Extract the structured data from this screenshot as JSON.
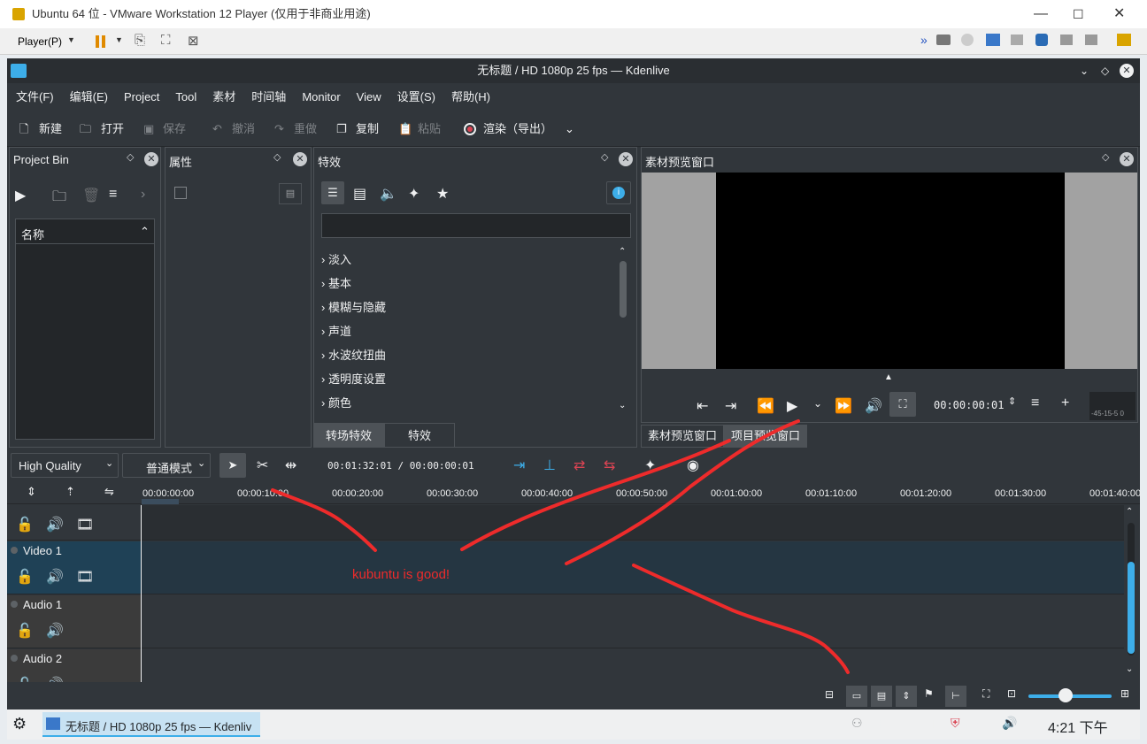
{
  "vmware": {
    "title": "Ubuntu 64 位 - VMware Workstation 12 Player (仅用于非商业用途)",
    "player_menu": "Player(P)"
  },
  "window": {
    "title": "无标题 / HD 1080p 25 fps — Kdenlive"
  },
  "menu": [
    "文件(F)",
    "编辑(E)",
    "Project",
    "Tool",
    "素材",
    "时间轴",
    "Monitor",
    "View",
    "设置(S)",
    "帮助(H)"
  ],
  "toolbar": {
    "new": "新建",
    "open": "打开",
    "save": "保存",
    "undo": "撤消",
    "redo": "重做",
    "copy": "复制",
    "paste": "粘贴",
    "render": "渲染（导出）"
  },
  "project_bin": {
    "title": "Project Bin",
    "column": "名称"
  },
  "properties": {
    "title": "属性"
  },
  "effects": {
    "title": "特效",
    "search_placeholder": "",
    "categories": [
      "淡入",
      "基本",
      "模糊与隐藏",
      "声道",
      "水波纹扭曲",
      "透明度设置",
      "颜色"
    ],
    "tabs": [
      "转场特效",
      "特效"
    ]
  },
  "monitor": {
    "title": "素材预览窗口",
    "timecode": "00:00:00:01",
    "tabs": [
      "素材预览窗口",
      "项目预览窗口"
    ],
    "meter_scale": "-45-15-5 0"
  },
  "timeline_toolbar": {
    "quality": "High Quality",
    "mode": "普通模式",
    "position": "00:01:32:01 / 00:00:00:01"
  },
  "ruler": [
    "00:00:00:00",
    "00:00:10:00",
    "00:00:20:00",
    "00:00:30:00",
    "00:00:40:00",
    "00:00:50:00",
    "00:01:00:00",
    "00:01:10:00",
    "00:01:20:00",
    "00:01:30:00",
    "00:01:40:00"
  ],
  "tracks": [
    {
      "name": ""
    },
    {
      "name": "Video 1"
    },
    {
      "name": "Audio 1"
    },
    {
      "name": "Audio 2"
    }
  ],
  "annotation": {
    "text": "kubuntu is good!",
    "color": "#ee2b2b"
  },
  "taskbar": {
    "active_task": "无标题 / HD 1080p 25 fps — Kdenliv",
    "clock": "4:21 下午"
  },
  "colors": {
    "accent": "#3daee9",
    "bg": "#31363b"
  }
}
